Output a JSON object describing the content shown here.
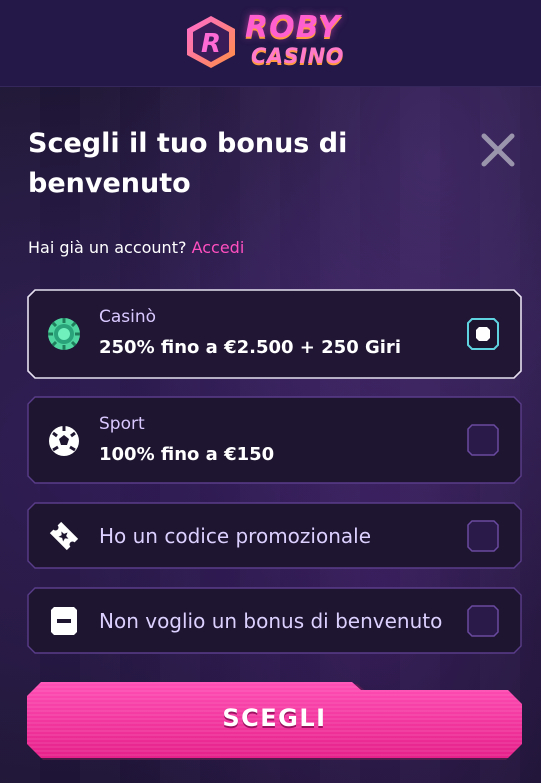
{
  "brand": {
    "line1": "ROBY",
    "line2": "CASINO",
    "badge_letter": "R"
  },
  "modal": {
    "title": "Scegli il tuo bonus di benvenuto",
    "account_prompt": "Hai già un account?",
    "login_link": "Accedi",
    "options": [
      {
        "label": "Casinò",
        "value": "250% fino a €2.500 + 250 Giri",
        "icon": "casino-chip-icon",
        "selected": true
      },
      {
        "label": "Sport",
        "value": "100% fino a €150",
        "icon": "soccer-ball-icon",
        "selected": false
      },
      {
        "label": "Ho un codice promozionale",
        "icon": "promo-ticket-icon",
        "selected": false
      },
      {
        "label": "Non voglio un bonus di benvenuto",
        "icon": "no-bonus-icon",
        "selected": false
      }
    ],
    "cta_label": "SCEGLI"
  },
  "colors": {
    "accent": "#ff3fa4",
    "selected_border": "#e6e0f0",
    "option_border": "#5a3d8a",
    "radio_active": "#5fd3e0"
  }
}
